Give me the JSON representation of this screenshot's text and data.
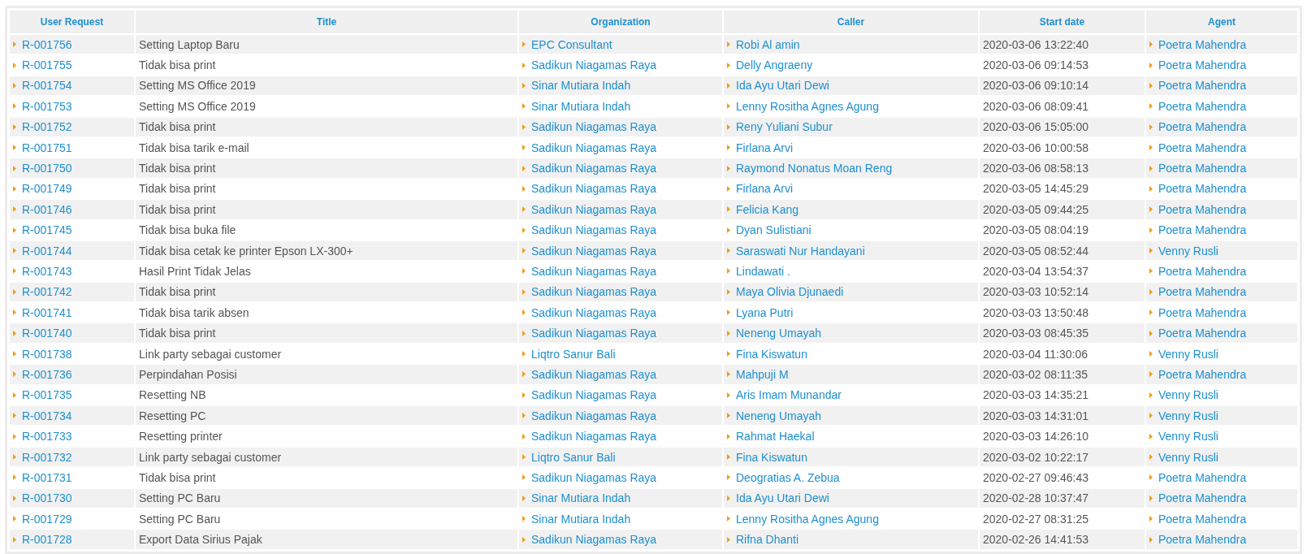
{
  "table": {
    "columns": [
      "User Request",
      "Title",
      "Organization",
      "Caller",
      "Start date",
      "Agent"
    ],
    "rows": [
      {
        "request": "R-001756",
        "title": "Setting Laptop Baru",
        "organization": "EPC Consultant",
        "caller": "Robi Al amin",
        "start_date": "2020-03-06 13:22:40",
        "agent": "Poetra Mahendra"
      },
      {
        "request": "R-001755",
        "title": "Tidak bisa print",
        "organization": "Sadikun Niagamas Raya",
        "caller": "Delly Angraeny",
        "start_date": "2020-03-06 09:14:53",
        "agent": "Poetra Mahendra"
      },
      {
        "request": "R-001754",
        "title": "Setting MS Office 2019",
        "organization": "Sinar Mutiara Indah",
        "caller": "Ida Ayu Utari Dewi",
        "start_date": "2020-03-06 09:10:14",
        "agent": "Poetra Mahendra"
      },
      {
        "request": "R-001753",
        "title": "Setting MS Office 2019",
        "organization": "Sinar Mutiara Indah",
        "caller": "Lenny Rositha Agnes Agung",
        "start_date": "2020-03-06 08:09:41",
        "agent": "Poetra Mahendra"
      },
      {
        "request": "R-001752",
        "title": "Tidak bisa print",
        "organization": "Sadikun Niagamas Raya",
        "caller": "Reny Yuliani Subur",
        "start_date": "2020-03-06 15:05:00",
        "agent": "Poetra Mahendra"
      },
      {
        "request": "R-001751",
        "title": "Tidak bisa tarik e-mail",
        "organization": "Sadikun Niagamas Raya",
        "caller": "Firlana Arvi",
        "start_date": "2020-03-06 10:00:58",
        "agent": "Poetra Mahendra"
      },
      {
        "request": "R-001750",
        "title": "Tidak bisa print",
        "organization": "Sadikun Niagamas Raya",
        "caller": "Raymond Nonatus Moan Reng",
        "start_date": "2020-03-06 08:58:13",
        "agent": "Poetra Mahendra"
      },
      {
        "request": "R-001749",
        "title": "Tidak bisa print",
        "organization": "Sadikun Niagamas Raya",
        "caller": "Firlana Arvi",
        "start_date": "2020-03-05 14:45:29",
        "agent": "Poetra Mahendra"
      },
      {
        "request": "R-001746",
        "title": "Tidak bisa print",
        "organization": "Sadikun Niagamas Raya",
        "caller": "Felicia Kang",
        "start_date": "2020-03-05 09:44:25",
        "agent": "Poetra Mahendra"
      },
      {
        "request": "R-001745",
        "title": "Tidak bisa buka file",
        "organization": "Sadikun Niagamas Raya",
        "caller": "Dyan Sulistiani",
        "start_date": "2020-03-05 08:04:19",
        "agent": "Poetra Mahendra"
      },
      {
        "request": "R-001744",
        "title": "Tidak bisa cetak ke printer Epson LX-300+",
        "organization": "Sadikun Niagamas Raya",
        "caller": "Saraswati Nur Handayani",
        "start_date": "2020-03-05 08:52:44",
        "agent": "Venny Rusli"
      },
      {
        "request": "R-001743",
        "title": "Hasil Print Tidak Jelas",
        "organization": "Sadikun Niagamas Raya",
        "caller": "Lindawati .",
        "start_date": "2020-03-04 13:54:37",
        "agent": "Poetra Mahendra"
      },
      {
        "request": "R-001742",
        "title": "Tidak bisa print",
        "organization": "Sadikun Niagamas Raya",
        "caller": "Maya Olivia Djunaedi",
        "start_date": "2020-03-03 10:52:14",
        "agent": "Poetra Mahendra"
      },
      {
        "request": "R-001741",
        "title": "Tidak bisa tarik absen",
        "organization": "Sadikun Niagamas Raya",
        "caller": "Lyana Putri",
        "start_date": "2020-03-03 13:50:48",
        "agent": "Poetra Mahendra"
      },
      {
        "request": "R-001740",
        "title": "Tidak bisa print",
        "organization": "Sadikun Niagamas Raya",
        "caller": "Neneng Umayah",
        "start_date": "2020-03-03 08:45:35",
        "agent": "Poetra Mahendra"
      },
      {
        "request": "R-001738",
        "title": "Link party sebagai customer",
        "organization": "Liqtro Sanur Bali",
        "caller": "Fina Kiswatun",
        "start_date": "2020-03-04 11:30:06",
        "agent": "Venny Rusli"
      },
      {
        "request": "R-001736",
        "title": "Perpindahan Posisi",
        "organization": "Sadikun Niagamas Raya",
        "caller": "Mahpuji M",
        "start_date": "2020-03-02 08:11:35",
        "agent": "Poetra Mahendra"
      },
      {
        "request": "R-001735",
        "title": "Resetting NB",
        "organization": "Sadikun Niagamas Raya",
        "caller": "Aris Imam Munandar",
        "start_date": "2020-03-03 14:35:21",
        "agent": "Venny Rusli"
      },
      {
        "request": "R-001734",
        "title": "Resetting PC",
        "organization": "Sadikun Niagamas Raya",
        "caller": "Neneng Umayah",
        "start_date": "2020-03-03 14:31:01",
        "agent": "Venny Rusli"
      },
      {
        "request": "R-001733",
        "title": "Resetting printer",
        "organization": "Sadikun Niagamas Raya",
        "caller": "Rahmat Haekal",
        "start_date": "2020-03-03 14:26:10",
        "agent": "Venny Rusli"
      },
      {
        "request": "R-001732",
        "title": "Link party sebagai customer",
        "organization": "Liqtro Sanur Bali",
        "caller": "Fina Kiswatun",
        "start_date": "2020-03-02 10:22:17",
        "agent": "Venny Rusli"
      },
      {
        "request": "R-001731",
        "title": "Tidak bisa print",
        "organization": "Sadikun Niagamas Raya",
        "caller": "Deogratias A. Zebua",
        "start_date": "2020-02-27 09:46:43",
        "agent": "Poetra Mahendra"
      },
      {
        "request": "R-001730",
        "title": "Setting PC Baru",
        "organization": "Sinar Mutiara Indah",
        "caller": "Ida Ayu Utari Dewi",
        "start_date": "2020-02-28 10:37:47",
        "agent": "Poetra Mahendra"
      },
      {
        "request": "R-001729",
        "title": "Setting PC Baru",
        "organization": "Sinar Mutiara Indah",
        "caller": "Lenny Rositha Agnes Agung",
        "start_date": "2020-02-27 08:31:25",
        "agent": "Poetra Mahendra"
      },
      {
        "request": "R-001728",
        "title": "Export Data Sirius Pajak",
        "organization": "Sadikun Niagamas Raya",
        "caller": "Rifna Dhanti",
        "start_date": "2020-02-26 14:41:53",
        "agent": "Poetra Mahendra"
      }
    ]
  }
}
